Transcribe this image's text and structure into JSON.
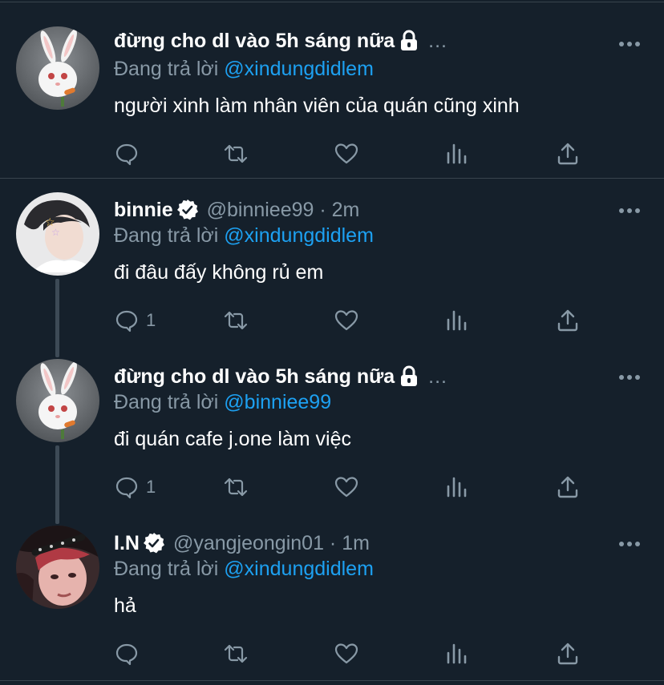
{
  "reply_prefix": "Đang trả lời",
  "tweets": [
    {
      "name": "đừng cho dl vào 5h sáng nữa",
      "handle": "",
      "time": "",
      "ellipsis": "...",
      "reply_to": "@xindungdidlem",
      "text": "người xinh làm nhân viên của quán cũng xinh",
      "reply_count": "",
      "icons": {
        "reply": "reply-icon",
        "retweet": "retweet-icon",
        "like": "heart-icon",
        "analytics": "analytics-icon",
        "share": "share-icon"
      }
    },
    {
      "name": "binnie",
      "handle": "@binniee99 · 2m",
      "reply_to": "@xindungdidlem",
      "text": "đi đâu đấy không rủ em",
      "reply_count": "1"
    },
    {
      "name": "đừng cho dl vào 5h sáng nữa",
      "handle": "",
      "ellipsis": "...",
      "reply_to": "@binniee99",
      "text": "đi quán cafe j.one làm việc",
      "reply_count": "1"
    },
    {
      "name": "I.N",
      "handle": "@yangjeongin01 · 1m",
      "reply_to": "@xindungdidlem",
      "text": "hả",
      "reply_count": ""
    }
  ],
  "colors": {
    "background": "#15202b",
    "secondary_text": "#8899a6",
    "mention": "#1da1f2",
    "verified": "#ffffff",
    "divider": "#38444d"
  }
}
